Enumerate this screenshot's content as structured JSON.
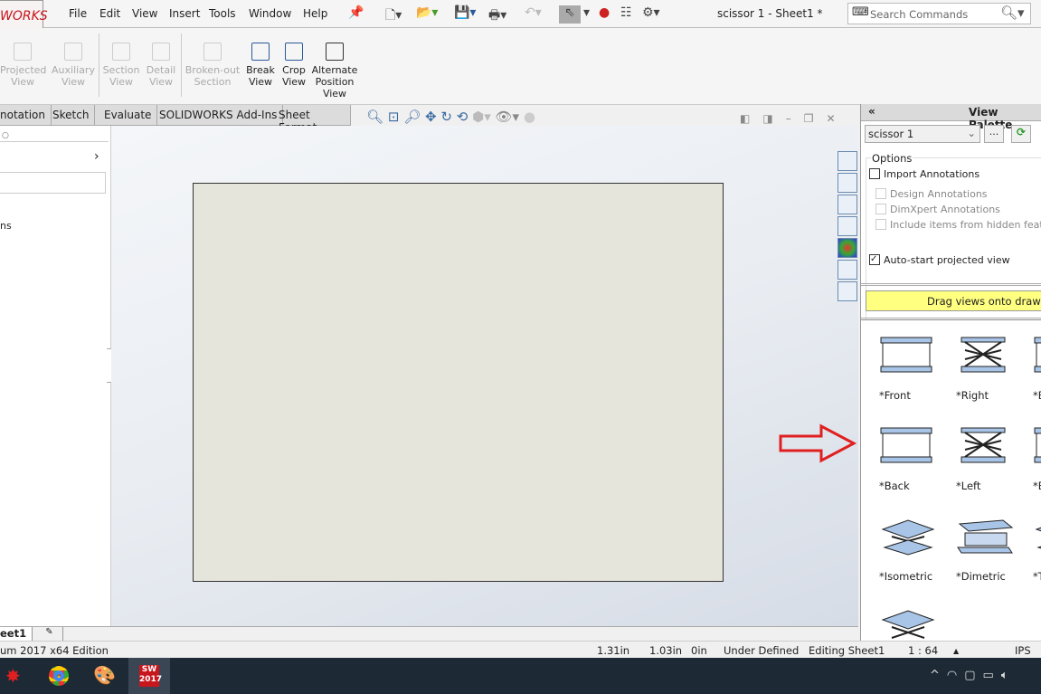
{
  "app": {
    "logo": "WORKS",
    "title": "scissor 1 - Sheet1 *"
  },
  "menu": [
    "File",
    "Edit",
    "View",
    "Insert",
    "Tools",
    "Window",
    "Help"
  ],
  "search": {
    "placeholder": "Search Commands"
  },
  "ribbon": [
    {
      "label": "Projected View",
      "enabled": false
    },
    {
      "label": "Auxiliary View",
      "enabled": false
    },
    {
      "label": "Section View",
      "enabled": false
    },
    {
      "label": "Detail View",
      "enabled": false
    },
    {
      "label": "Broken-out Section",
      "enabled": false
    },
    {
      "label": "Break View",
      "enabled": true
    },
    {
      "label": "Crop View",
      "enabled": true
    },
    {
      "label": "Alternate Position View",
      "enabled": true
    }
  ],
  "tabs": [
    "notation",
    "Sketch",
    "Evaluate",
    "SOLIDWORKS Add-Ins",
    "Sheet Format"
  ],
  "left_panel": {
    "partial_text": "ns"
  },
  "palette": {
    "title": "View Palette",
    "collapse": "«",
    "model": "scissor 1",
    "browse": "...",
    "options_label": "Options",
    "import_annotations": {
      "label": "Import Annotations",
      "checked": false
    },
    "sub_options": [
      "Design Annotations",
      "DimXpert Annotations",
      "Include items from hidden featur"
    ],
    "auto_start": {
      "label": "Auto-start projected view",
      "checked": true
    },
    "hint": "Drag views onto drawing",
    "hint_color": "#ffff80",
    "views": [
      "*Front",
      "*Right",
      "*B",
      "*Back",
      "*Left",
      "*B",
      "*Isometric",
      "*Dimetric",
      "*Tr"
    ]
  },
  "sheet_tabs": [
    "eet1"
  ],
  "status": {
    "edition": "um 2017 x64 Edition",
    "x": "1.31in",
    "y": "1.03in",
    "z": "0in",
    "state": "Under Defined",
    "mode": "Editing Sheet1",
    "scale": "1 : 64",
    "units": "IPS"
  },
  "annotation_arrow_color": "#e02020"
}
